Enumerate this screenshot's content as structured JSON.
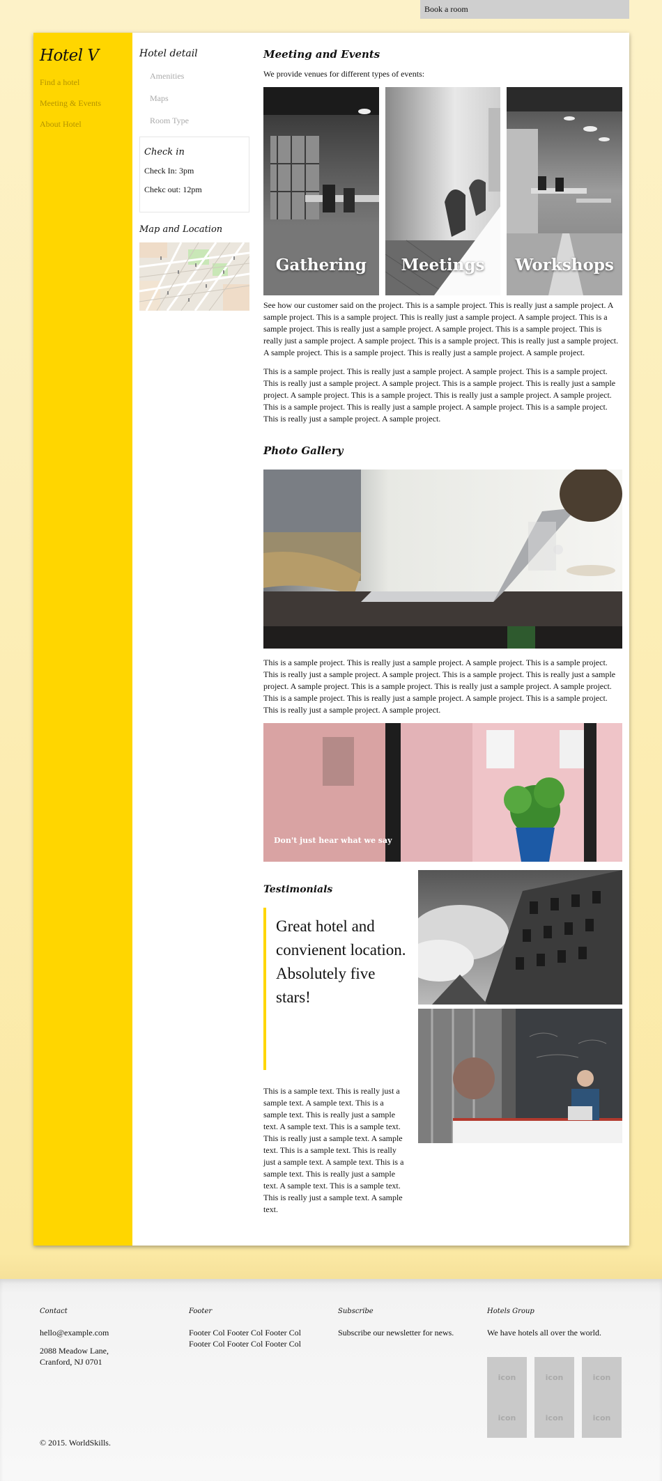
{
  "top_bar": {
    "book_label": "Book a room"
  },
  "sidebar": {
    "brand": "Hotel V",
    "items": [
      {
        "label": "Find a hotel"
      },
      {
        "label": "Meeting & Events"
      },
      {
        "label": "About Hotel"
      }
    ]
  },
  "hotel_detail": {
    "title": "Hotel detail",
    "links": [
      {
        "label": "Amenities"
      },
      {
        "label": "Maps"
      },
      {
        "label": "Room Type"
      }
    ],
    "checkin": {
      "title": "Check in",
      "check_in": "Check In: 3pm",
      "check_out": "Chekc out: 12pm"
    },
    "map_title": "Map and Location"
  },
  "events": {
    "title": "Meeting and Events",
    "intro": "We provide venues for different types of events:",
    "tiles": [
      {
        "label": "Gathering"
      },
      {
        "label": "Meetings"
      },
      {
        "label": "Workshops"
      }
    ],
    "para1": "See how our customer said on the project. This is a sample project. This is really just a sample project. A sample project. This is a sample project. This is really just a sample project. A sample project. This is a sample project. This is really just a sample project. A sample project. This is a sample project. This is really just a sample project. A sample project. This is a sample project. This is really just a sample project. A sample project. This is a sample project. This is really just a sample project. A sample project.",
    "para2": "This is a sample project. This is really just a sample project. A sample project. This is a sample project. This is really just a sample project. A sample project. This is a sample project. This is really just a sample project. A sample project. This is a sample project. This is really just a sample project. A sample project. This is a sample project. This is really just a sample project. A sample project. This is a sample project. This is really just a sample project. A sample project."
  },
  "gallery": {
    "title": "Photo Gallery",
    "para": "This is a sample project. This is really just a sample project. A sample project. This is a sample project. This is really just a sample project. A sample project. This is a sample project. This is really just a sample project. A sample project. This is a sample project. This is really just a sample project. A sample project. This is a sample project. This is really just a sample project. A sample project. This is a sample project. This is really just a sample project. A sample project.",
    "plant_caption": "Don't just hear what we say"
  },
  "testimonials": {
    "title": "Testimonials",
    "quote": "Great hotel and convienent location. Absolutely five stars!",
    "text": "This is a sample text. This is really just a sample text. A sample text. This is a sample text. This is really just a sample text. A sample text. This is a sample text. This is really just a sample text. A sample text. This is a sample text. This is really just a sample text. A sample text. This is a sample text. This is really just a sample text. A sample text. This is a sample text. This is really just a sample text. A sample text."
  },
  "footer": {
    "contact": {
      "title": "Contact",
      "email": "hello@example.com",
      "address_line1": "2088 Meadow Lane,",
      "address_line2": "Cranford, NJ 0701"
    },
    "footer_col": {
      "title": "Footer",
      "line1": "Footer Col Footer Col Footer Col",
      "line2": "Footer Col Footer Col Footer Col"
    },
    "subscribe": {
      "title": "Subscribe",
      "text": "Subscribe our newsletter for news."
    },
    "group": {
      "title": "Hotels Group",
      "text": "We have hotels all over the world.",
      "icons": [
        "icon",
        "icon",
        "icon",
        "icon",
        "icon",
        "icon"
      ]
    },
    "copyright": "© 2015. WorldSkills."
  },
  "colors": {
    "accent": "#ffd600",
    "nav_text": "#b39300",
    "background_top": "#fdf2c8",
    "background_bottom": "#f6e19a"
  }
}
